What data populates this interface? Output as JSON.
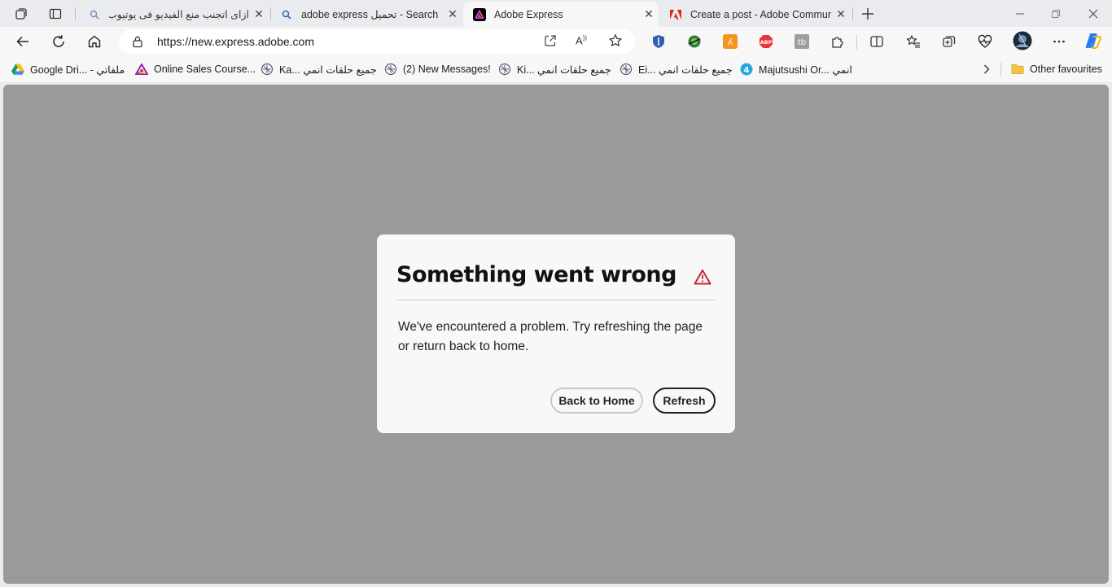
{
  "tabs": [
    {
      "title": "ازاى اتجنب منع الفيديو فى يوتيوب",
      "favicon": "search-icon",
      "active": false
    },
    {
      "title": "adobe express تحميل - Search",
      "favicon": "search-icon",
      "active": false
    },
    {
      "title": "Adobe Express",
      "favicon": "adobe-express-icon",
      "active": true
    },
    {
      "title": "Create a post - Adobe Community",
      "favicon": "adobe-icon",
      "active": false
    }
  ],
  "address_bar": {
    "url": "https://new.express.adobe.com"
  },
  "bookmarks": [
    {
      "label": "Google Dri... - ملفاتي",
      "icon": "google-drive-icon"
    },
    {
      "label": "Online Sales Course...",
      "icon": "course-icon"
    },
    {
      "label": "Ka... جميع حلقات انمي",
      "icon": "anime-site-icon"
    },
    {
      "label": "(2) New Messages!",
      "icon": "anime-site-icon"
    },
    {
      "label": "Ki... جميع حلقات انمي",
      "icon": "anime-site-icon"
    },
    {
      "label": "Ei... جميع حلقات انمي",
      "icon": "anime-site-icon"
    },
    {
      "label": "Majutsushi Or... انمي",
      "icon": "anime4-icon"
    }
  ],
  "other_favourites": "Other favourites",
  "dialog": {
    "title": "Something went wrong",
    "body": "We've encountered a problem. Try refreshing the page or return back to home.",
    "back_label": "Back to Home",
    "refresh_label": "Refresh"
  },
  "colors": {
    "overlay": "#9a9a9a",
    "dialog_bg": "#f8f8f8",
    "alert": "#c9252d"
  }
}
